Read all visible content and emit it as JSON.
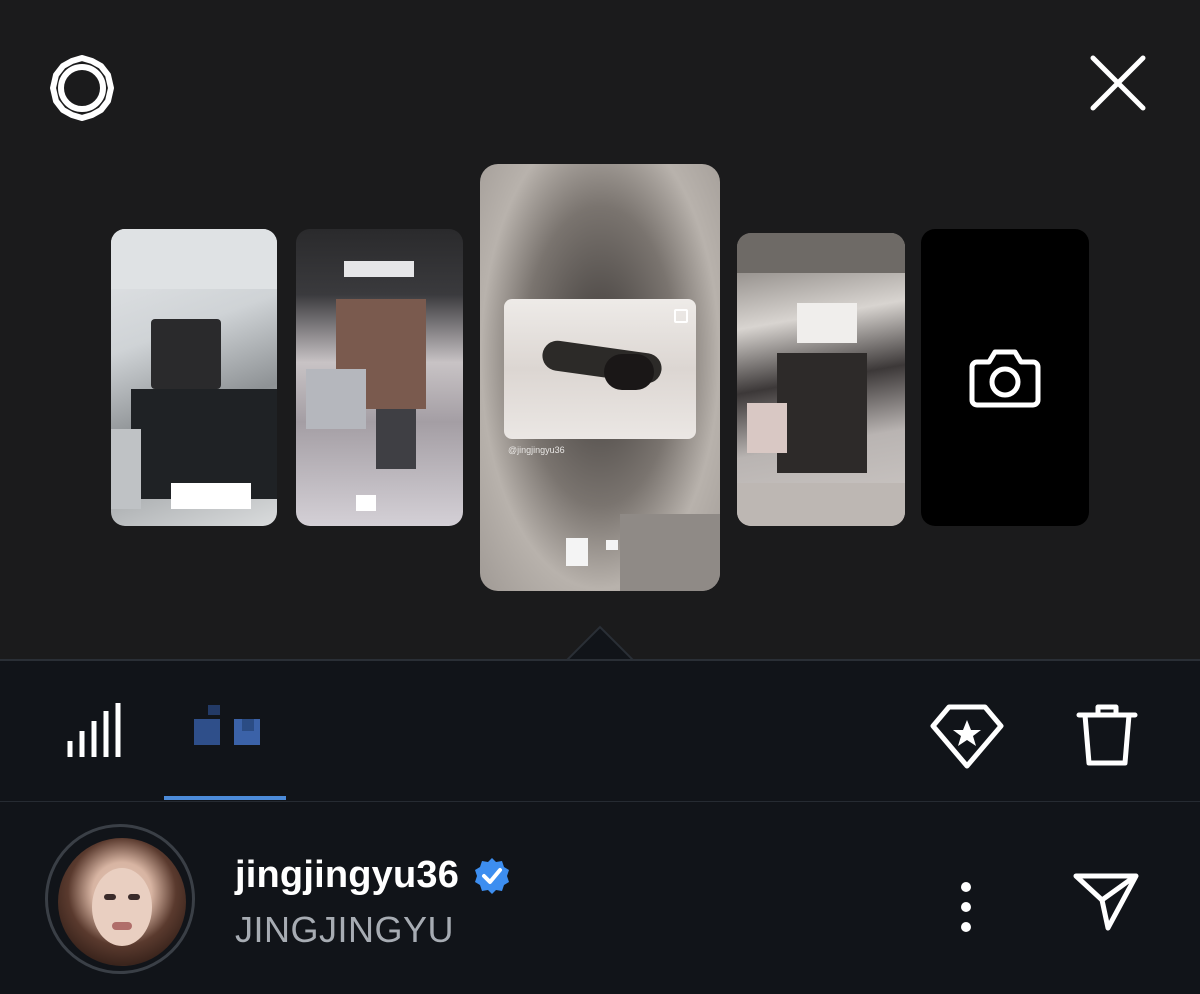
{
  "story_viewer": {
    "thumbnails": [
      {
        "type": "story",
        "caption": ""
      },
      {
        "type": "story",
        "caption": ""
      },
      {
        "type": "story",
        "caption": "@jingjingyu36",
        "selected": true
      },
      {
        "type": "story",
        "caption": ""
      },
      {
        "type": "add-story"
      }
    ]
  },
  "icons": {
    "settings": "gear-icon",
    "close": "close-icon",
    "camera": "camera-icon",
    "stats": "bar-chart-icon",
    "highlight": "diamond-star-icon",
    "delete": "trash-icon",
    "verified": "verified-badge-icon",
    "more": "more-vertical-icon",
    "send": "send-icon"
  },
  "tabs": {
    "selected": "viewers"
  },
  "profile": {
    "username": "jingjingyu36",
    "display_name": "JINGJINGYU",
    "verified": true
  },
  "colors": {
    "background_top": "#1b1b1c",
    "background_bottom": "#111419",
    "accent": "#4c8bd9",
    "verified": "#3d8ef0",
    "secondary_text": "#a7acb3"
  }
}
